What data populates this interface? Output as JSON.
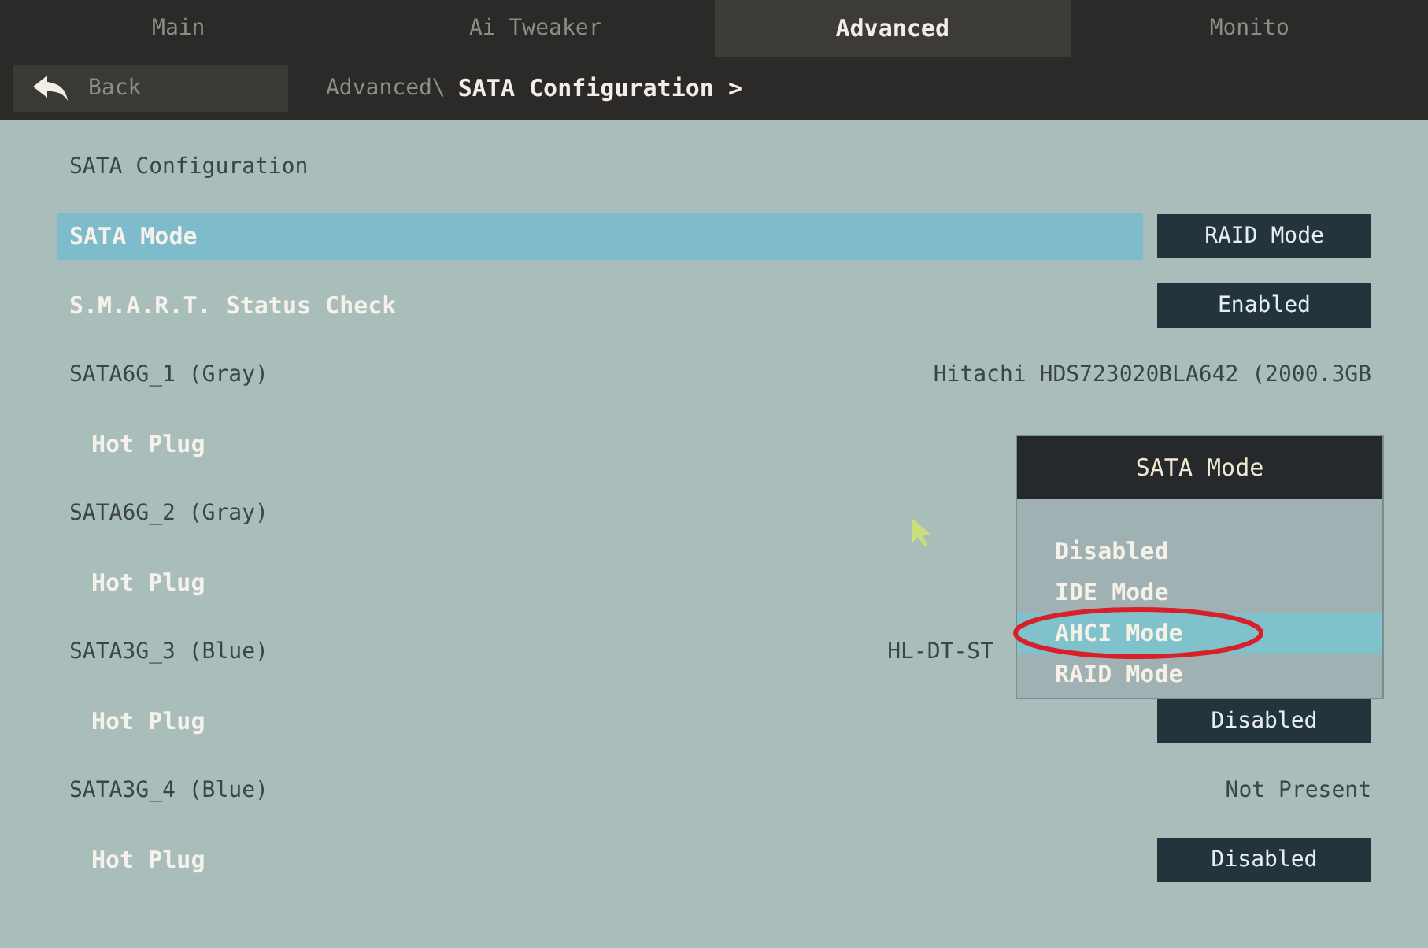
{
  "tabs": [
    {
      "label": "Main",
      "selected": false
    },
    {
      "label": "Ai Tweaker",
      "selected": false
    },
    {
      "label": "Advanced",
      "selected": true
    },
    {
      "label": "Monito",
      "selected": false
    }
  ],
  "back": {
    "label": "Back"
  },
  "breadcrumb": {
    "path": "Advanced\\",
    "current": "SATA Configuration >"
  },
  "rows": [
    {
      "kind": "header",
      "label": "SATA Configuration",
      "selected": false
    },
    {
      "kind": "setting",
      "label": "SATA Mode",
      "value": "RAID Mode",
      "selected": true
    },
    {
      "kind": "setting",
      "label": "S.M.A.R.T. Status Check",
      "value": "Enabled",
      "selected": false
    },
    {
      "kind": "device",
      "label": "SATA6G_1 (Gray)",
      "value": "Hitachi HDS723020BLA642 (2000.3GB",
      "selected": false
    },
    {
      "kind": "sub",
      "label": "Hot Plug",
      "selected": false
    },
    {
      "kind": "device",
      "label": "SATA6G_2 (Gray)",
      "selected": false
    },
    {
      "kind": "sub",
      "label": "Hot Plug",
      "selected": false
    },
    {
      "kind": "device-left",
      "label": "SATA3G_3 (Blue)",
      "value": "HL-DT-ST",
      "selected": false
    },
    {
      "kind": "sub",
      "label": "Hot Plug",
      "value": "Disabled",
      "selected": false
    },
    {
      "kind": "device",
      "label": "SATA3G_4 (Blue)",
      "value": "Not Present",
      "selected": false
    },
    {
      "kind": "sub",
      "label": "Hot Plug",
      "value": "Disabled",
      "selected": false
    }
  ],
  "popup": {
    "title": "SATA Mode",
    "options": [
      {
        "label": "Disabled",
        "selected": false
      },
      {
        "label": "IDE Mode",
        "selected": false
      },
      {
        "label": "AHCI Mode",
        "selected": true
      },
      {
        "label": "RAID Mode",
        "selected": false
      }
    ]
  }
}
